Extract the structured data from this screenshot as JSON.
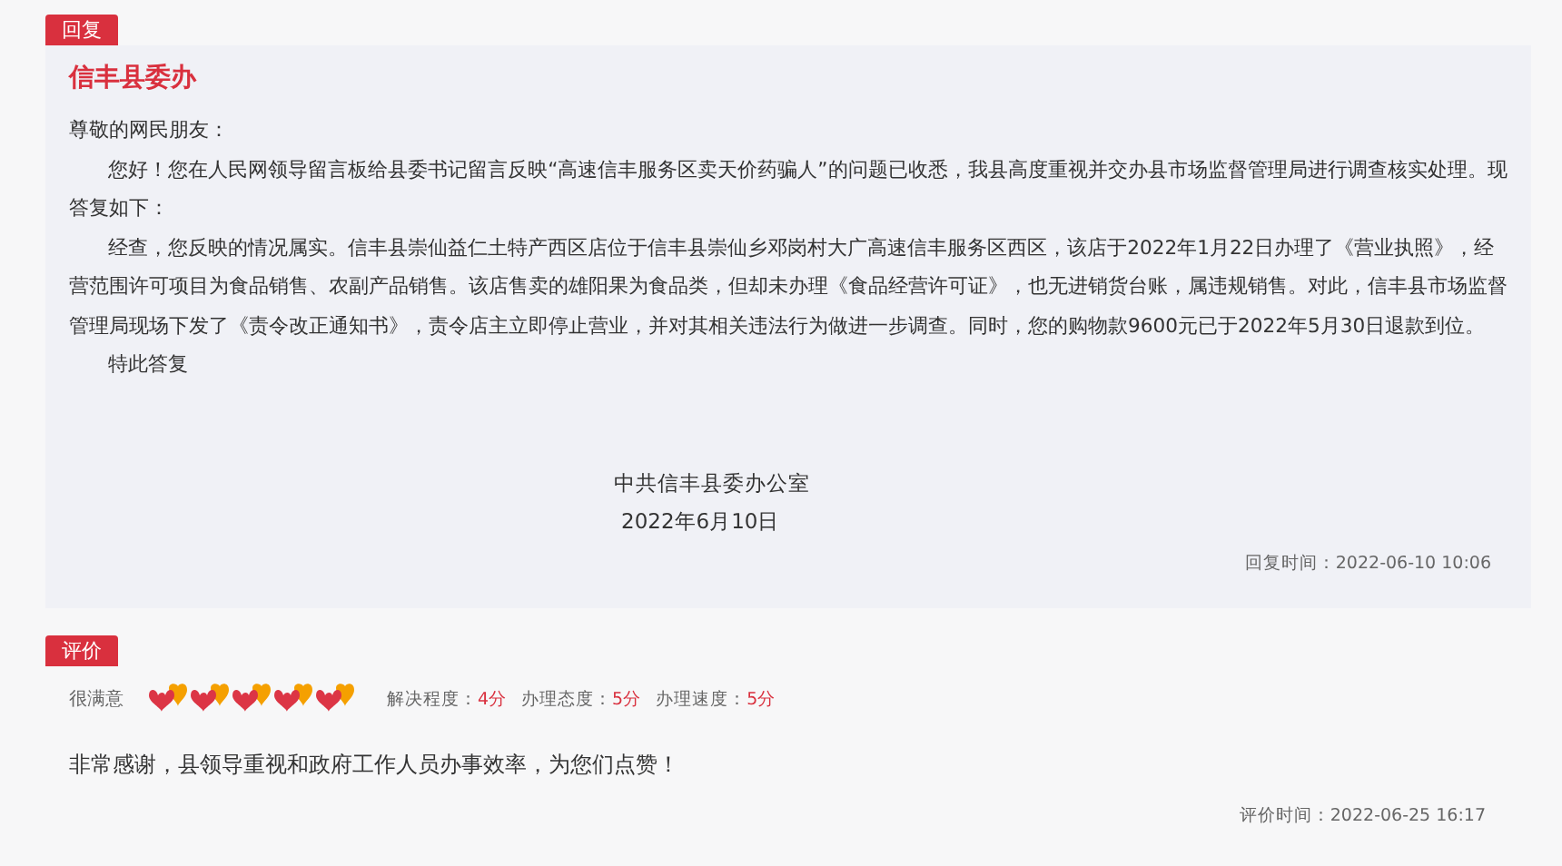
{
  "reply": {
    "tag": "回复",
    "office": "信丰县委办",
    "greeting": "尊敬的网民朋友：",
    "paragraphs": [
      "您好！您在人民网领导留言板给县委书记留言反映“高速信丰服务区卖天价药骗人”的问题已收悉，我县高度重视并交办县市场监督管理局进行调查核实处理。现答复如下：",
      "经查，您反映的情况属实。信丰县崇仙益仁土特产西区店位于信丰县崇仙乡邓岗村大广高速信丰服务区西区，该店于2022年1月22日办理了《营业执照》，经营范围许可项目为食品销售、农副产品销售。该店售卖的雄阳果为食品类，但却未办理《食品经营许可证》，也无进销货台账，属违规销售。对此，信丰县市场监督管理局现场下发了《责令改正通知书》，责令店主立即停止营业，并对其相关违法行为做进一步调查。同时，您的购物款9600元已于2022年5月30日退款到位。",
      "特此答复"
    ],
    "signature": "中共信丰县委办公室",
    "date": "2022年6月10日",
    "reply_time": "回复时间：2022-06-10 10:06"
  },
  "evaluation": {
    "tag": "评价",
    "rating": {
      "label": "很满意",
      "stars": 5
    },
    "scores": [
      {
        "label": "解决程度：",
        "value": "4分"
      },
      {
        "label": "办理态度：",
        "value": "5分"
      },
      {
        "label": "办理速度：",
        "value": "5分"
      }
    ],
    "comment": "非常感谢，县领导重视和政府工作人员办事效率，为您们点赞！",
    "eval_time": "评价时间：2022-06-25 16:17"
  }
}
